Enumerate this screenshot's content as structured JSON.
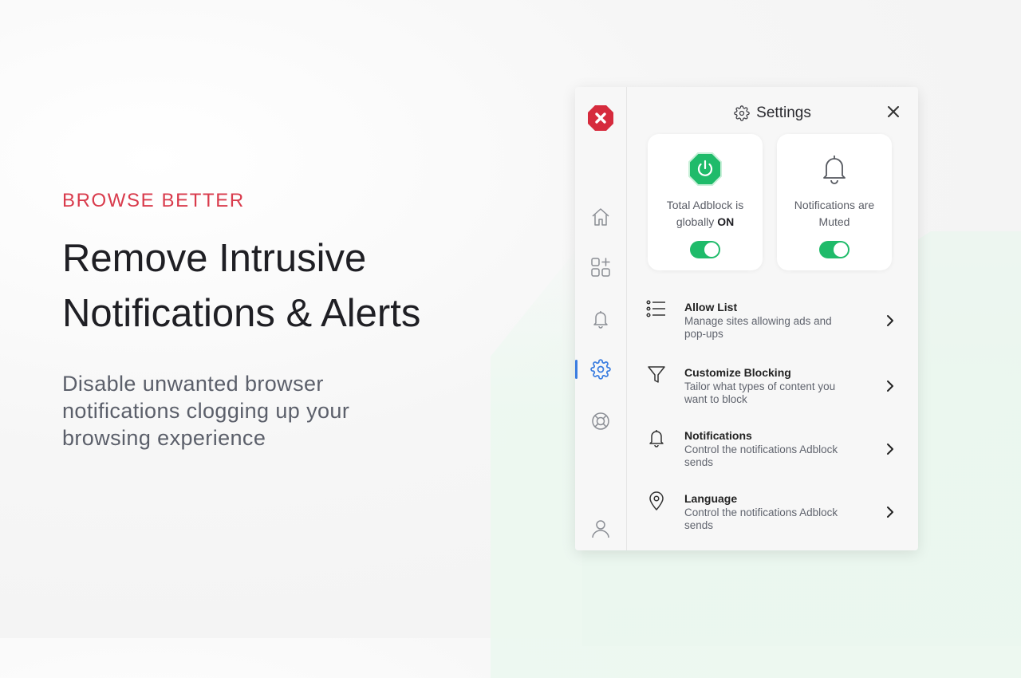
{
  "hero": {
    "kicker": "BROWSE BETTER",
    "headline_line1": "Remove Intrusive",
    "headline_line2": "Notifications & Alerts",
    "subtext": "Disable unwanted browser notifications clogging up your browsing experience"
  },
  "panel": {
    "title": "Settings",
    "sidebar": {
      "items": [
        {
          "name": "home",
          "icon": "home-icon"
        },
        {
          "name": "apps",
          "icon": "apps-add-icon"
        },
        {
          "name": "notifications",
          "icon": "bell-icon"
        },
        {
          "name": "settings",
          "icon": "gear-icon",
          "active": true
        },
        {
          "name": "support",
          "icon": "lifebuoy-icon"
        },
        {
          "name": "account",
          "icon": "user-icon"
        }
      ]
    },
    "cards": [
      {
        "text_prefix": "Total Adblock is globally ",
        "text_strong": "ON",
        "toggle_on": true,
        "icon": "power-icon"
      },
      {
        "text": "Notifications are Muted",
        "toggle_on": true,
        "icon": "bell-icon"
      }
    ],
    "rows": [
      {
        "title": "Allow List",
        "desc": "Manage sites allowing ads and pop-ups",
        "icon": "list-icon"
      },
      {
        "title": "Customize Blocking",
        "desc": "Tailor what types of content you want to block",
        "icon": "filter-icon"
      },
      {
        "title": "Notifications",
        "desc": "Control the notifications Adblock sends",
        "icon": "bell-icon"
      },
      {
        "title": "Language",
        "desc": "Control the notifications Adblock sends",
        "icon": "location-pin-icon"
      }
    ]
  },
  "colors": {
    "accent_red": "#d93b4c",
    "toggle_green": "#1fbb6a",
    "active_blue": "#3a7de0",
    "logo_red": "#d62b3d"
  }
}
